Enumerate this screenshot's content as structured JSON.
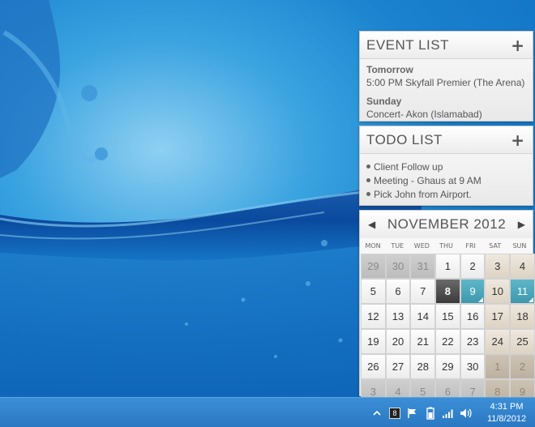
{
  "event_list": {
    "title": "EVENT LIST",
    "add_symbol": "+",
    "groups": [
      {
        "day": "Tomorrow",
        "items": [
          "5:00 PM Skyfall Premier (The Arena)"
        ]
      },
      {
        "day": "Sunday",
        "items": [
          "Concert- Akon (Islamabad)"
        ]
      }
    ]
  },
  "todo_list": {
    "title": "TODO LIST",
    "add_symbol": "+",
    "items": [
      "Client Follow up",
      "Meeting - Ghaus at 9 AM",
      "Pick John from Airport."
    ]
  },
  "calendar": {
    "prev_symbol": "◀",
    "next_symbol": "▶",
    "month_title": "NOVEMBER 2012",
    "days_of_week": [
      "MON",
      "TUE",
      "WED",
      "THU",
      "FRI",
      "SAT",
      "SUN"
    ],
    "weeks": [
      [
        {
          "d": "29",
          "o": 1
        },
        {
          "d": "30",
          "o": 1
        },
        {
          "d": "31",
          "o": 1
        },
        {
          "d": "1"
        },
        {
          "d": "2"
        },
        {
          "d": "3"
        },
        {
          "d": "4"
        }
      ],
      [
        {
          "d": "5"
        },
        {
          "d": "6"
        },
        {
          "d": "7"
        },
        {
          "d": "8",
          "today": 1
        },
        {
          "d": "9",
          "event": 1
        },
        {
          "d": "10"
        },
        {
          "d": "11",
          "event": 1
        }
      ],
      [
        {
          "d": "12"
        },
        {
          "d": "13"
        },
        {
          "d": "14"
        },
        {
          "d": "15"
        },
        {
          "d": "16"
        },
        {
          "d": "17"
        },
        {
          "d": "18"
        }
      ],
      [
        {
          "d": "19"
        },
        {
          "d": "20"
        },
        {
          "d": "21"
        },
        {
          "d": "22"
        },
        {
          "d": "23"
        },
        {
          "d": "24"
        },
        {
          "d": "25"
        }
      ],
      [
        {
          "d": "26"
        },
        {
          "d": "27"
        },
        {
          "d": "28"
        },
        {
          "d": "29"
        },
        {
          "d": "30"
        },
        {
          "d": "1",
          "o": 1
        },
        {
          "d": "2",
          "o": 1
        }
      ],
      [
        {
          "d": "3",
          "o": 1
        },
        {
          "d": "4",
          "o": 1
        },
        {
          "d": "5",
          "o": 1
        },
        {
          "d": "6",
          "o": 1
        },
        {
          "d": "7",
          "o": 1
        },
        {
          "d": "8",
          "o": 1
        },
        {
          "d": "9",
          "o": 1
        }
      ]
    ]
  },
  "taskbar": {
    "tray_icons": [
      "chevron-up-icon",
      "badge-icon",
      "flag-icon",
      "battery-icon",
      "signal-icon",
      "speaker-icon"
    ],
    "badge_count": "8",
    "time": "4:31 PM",
    "date": "11/8/2012"
  },
  "colors": {
    "accent_today": "#4a4a4a",
    "accent_event": "#4ba7bb",
    "taskbar": "#2f81c9"
  }
}
